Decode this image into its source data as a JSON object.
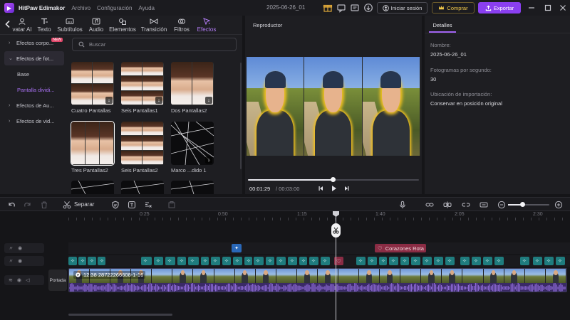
{
  "app": {
    "name": "HitPaw Edimakor",
    "menus": [
      "Archivo",
      "Configuración",
      "Ayuda"
    ],
    "project_name": "2025-06-26_01",
    "login_label": "Iniciar sesión",
    "buy_label": "Comprar",
    "export_label": "Exportar"
  },
  "colors": {
    "accent": "#8a3ff0",
    "active_tab": "#b27cf5",
    "fx_clip": "#1f7c7e",
    "sticker_clip": "#8a2c44",
    "buy_gold": "#f0c84a"
  },
  "toolbar": {
    "tabs": [
      {
        "label": "vatar AI",
        "icon": "avatar-icon"
      },
      {
        "label": "Texto",
        "icon": "text-icon"
      },
      {
        "label": "Subtítulos",
        "icon": "subtitles-icon"
      },
      {
        "label": "Audio",
        "icon": "audio-icon"
      },
      {
        "label": "Elementos",
        "icon": "elements-icon"
      },
      {
        "label": "Transición",
        "icon": "transition-icon"
      },
      {
        "label": "Filtros",
        "icon": "filters-icon"
      },
      {
        "label": "Efectos",
        "icon": "effects-icon"
      }
    ]
  },
  "sidebar": {
    "items": [
      {
        "label": "Efectos corpo...",
        "badge": "NEW"
      },
      {
        "label": "Efectos de fot..."
      },
      {
        "label": "Base"
      },
      {
        "label": "Pantalla dividi..."
      },
      {
        "label": "Efectos de Au..."
      },
      {
        "label": "Efectos de vid..."
      }
    ]
  },
  "search": {
    "placeholder": "Buscar"
  },
  "effects": [
    {
      "label": "Cuatro Pantallas",
      "grid": "2x2"
    },
    {
      "label": "Seis Pantallas1",
      "grid": "3x2"
    },
    {
      "label": "Dos Pantallas2",
      "grid": "2x1"
    },
    {
      "label": "Tres Pantallas2",
      "grid": "3x1"
    },
    {
      "label": "Seis Pantallas2",
      "grid": "3x2"
    },
    {
      "label": "Marco ...dido 1",
      "grid": "crack"
    }
  ],
  "player": {
    "title": "Reproductor",
    "current_time": "00:01:29",
    "total_time": "/ 00:03:00",
    "progress": 0.494
  },
  "details": {
    "tab": "Detalles",
    "name_label": "Nombre:",
    "name_value": "2025-06-26_01",
    "fps_label": "Fotogramas por segundo:",
    "fps_value": "30",
    "import_label": "Ubicación de importación:",
    "import_value": "Conservar en posición original"
  },
  "timeline": {
    "split_label": "Separar",
    "ruler": [
      "0:25",
      "0:50",
      "1:15",
      "1:40",
      "2:05",
      "2:30"
    ],
    "sticker_clip": "Corazones Rota",
    "video_clip": "12:38  28722266608-1-16",
    "cover_label": "Portada",
    "zoom": 0.35
  }
}
